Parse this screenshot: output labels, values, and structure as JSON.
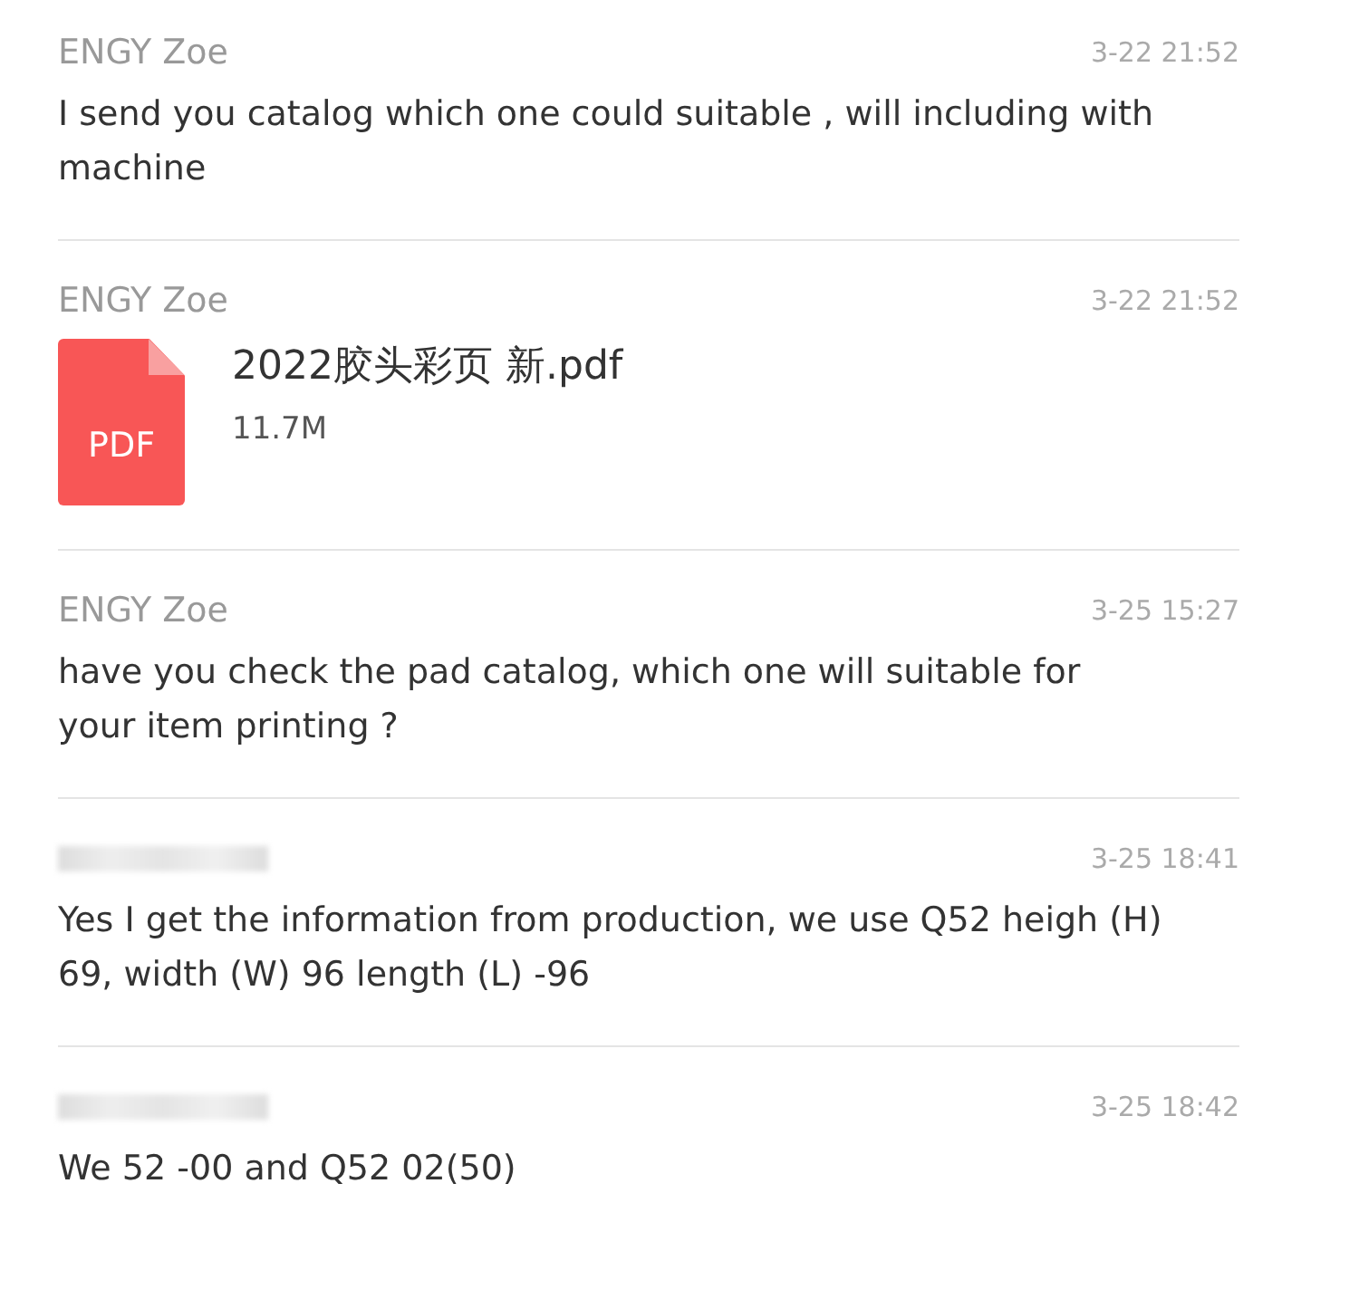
{
  "messages": [
    {
      "kind": "text",
      "sender_hidden": false,
      "sender": "ENGY Zoe",
      "time": "3-22 21:52",
      "text": "I send you catalog which one could suitable , will including with machine"
    },
    {
      "kind": "file",
      "sender_hidden": false,
      "sender": "ENGY Zoe",
      "time": "3-22 21:52",
      "file_type": "PDF",
      "file_name": "2022胶头彩页 新.pdf",
      "file_size": "11.7M"
    },
    {
      "kind": "text",
      "sender_hidden": false,
      "sender": "ENGY Zoe",
      "time": "3-25 15:27",
      "text": "have you check the pad catalog, which one will suitable for your item printing ?"
    },
    {
      "kind": "text",
      "sender_hidden": true,
      "time": "3-25 18:41",
      "text": "Yes I get the information from production, we use Q52 heigh (H) 69, width (W) 96 length (L) -96"
    },
    {
      "kind": "text",
      "sender_hidden": true,
      "time": "3-25 18:42",
      "text": "We 52 -00 and Q52 02(50)"
    }
  ]
}
